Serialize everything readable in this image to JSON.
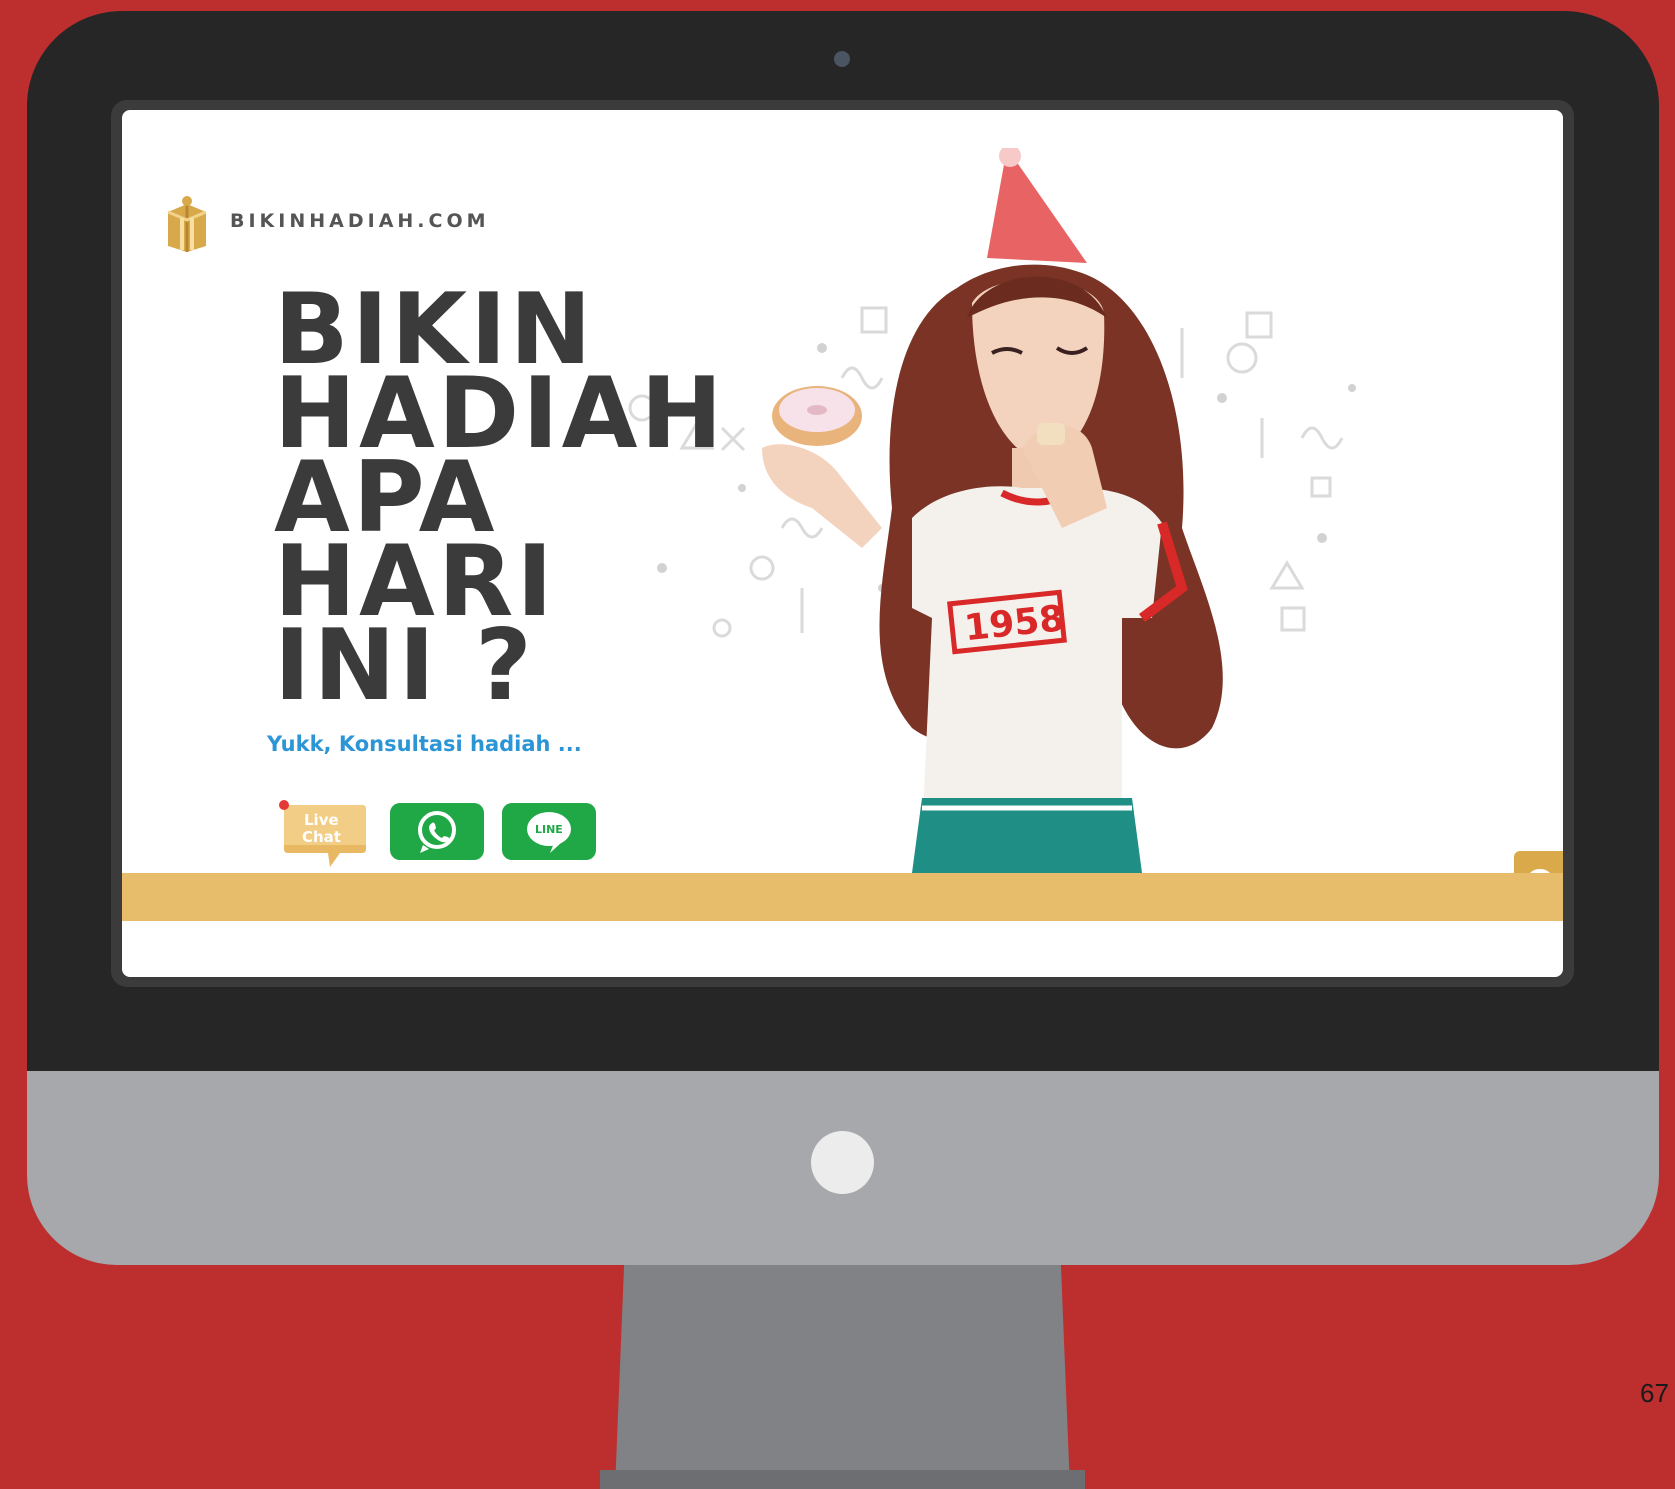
{
  "site": {
    "brand_name": "BIKINHADIAH.COM"
  },
  "hero": {
    "headline_lines": [
      "BIKIN",
      "HADIAH",
      "APA",
      "HARI",
      "INI ?"
    ],
    "subtitle": "Yukk, Konsultasi hadiah ...",
    "shirt_number": "1958"
  },
  "contact": {
    "live_chat_label_line1": "Live",
    "live_chat_label_line2": "Chat",
    "line_label": "LINE",
    "whatsapp_icon": "whatsapp-icon"
  },
  "footer": {
    "page_number": "67"
  },
  "colors": {
    "background": "#bd2f2f",
    "bezel": "#262626",
    "chin": "#a7a8ab",
    "gold": "#e7bc6a",
    "headline": "#3b3b3b",
    "subtitle": "#2b95d6",
    "green": "#1fa845"
  }
}
